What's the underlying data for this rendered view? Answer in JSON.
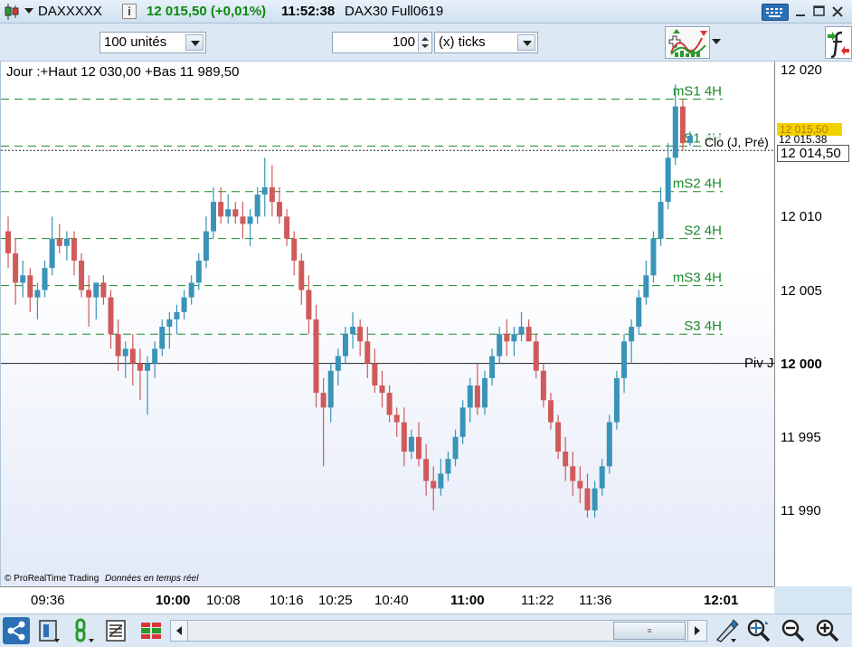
{
  "title": {
    "symbol": "DAXXXXX",
    "info_icon": "i",
    "price_change": "12 015,50 (+0,01%)",
    "time": "11:52:38",
    "instrument": "DAX30 Full0619"
  },
  "toolbar": {
    "units_value": "100 unités",
    "ticks_value": "100",
    "ticks_unit": "(x) ticks"
  },
  "chart": {
    "header_text": "Jour :+Haut 12 030,00 +Bas 11 989,50",
    "copyright": "© ProRealTime Trading",
    "realtime": "Données en temps réel",
    "levels": [
      {
        "label": "mS1 4H"
      },
      {
        "label": "S1 4H"
      },
      {
        "label": "mS2 4H"
      },
      {
        "label": "S2 4H"
      },
      {
        "label": "mS3 4H"
      },
      {
        "label": "S3 4H"
      }
    ],
    "clo_label": "Clo (J, Pré)",
    "piv_label": "Piv J"
  },
  "price_axis": {
    "ticks": [
      "12 020",
      "12 010",
      "12 005",
      "11 995",
      "11 990"
    ],
    "bold_tick": "12 000",
    "last_price": "12 015,50",
    "clo_price": "12 015.38",
    "prev_price": "12 014,50"
  },
  "time_axis": {
    "labels": [
      "09:36",
      "10:00",
      "10:08",
      "10:16",
      "10:25",
      "10:40",
      "11:00",
      "11:22",
      "11:36",
      "12:01"
    ],
    "bold": [
      "10:00",
      "11:00",
      "12:01"
    ]
  },
  "chart_data": {
    "type": "candlestick",
    "ylim": [
      11987,
      12021
    ],
    "levels": {
      "mS1 4H": 12018,
      "S1 4H": 12014.8,
      "mS2 4H": 12011.7,
      "S2 4H": 12008.5,
      "mS3 4H": 12005.3,
      "S3 4H": 12002,
      "Piv J": 12000,
      "Clo": 12014.5
    },
    "candles": [
      [
        12009,
        12010,
        12006.5,
        12007.5
      ],
      [
        12007.5,
        12008.5,
        12004,
        12005.5
      ],
      [
        12005.5,
        12007,
        12004.5,
        12006
      ],
      [
        12006,
        12006.5,
        12003.5,
        12004.5
      ],
      [
        12004.5,
        12005.5,
        12003,
        12005
      ],
      [
        12005,
        12007,
        12004.5,
        12006.5
      ],
      [
        12006.5,
        12010,
        12006,
        12008.5
      ],
      [
        12008.5,
        12009.5,
        12007.5,
        12008
      ],
      [
        12008,
        12009,
        12007,
        12008.5
      ],
      [
        12008.5,
        12009,
        12006,
        12007
      ],
      [
        12007,
        12007.5,
        12004.5,
        12005
      ],
      [
        12005,
        12006,
        12002.5,
        12004.5
      ],
      [
        12004.5,
        12005.5,
        12003,
        12005.5
      ],
      [
        12005.5,
        12006,
        12004,
        12004.5
      ],
      [
        12004.5,
        12005,
        12001,
        12002
      ],
      [
        12002,
        12003,
        11999.5,
        12000.5
      ],
      [
        12000.5,
        12001.5,
        11999,
        12001
      ],
      [
        12001,
        12002,
        11998.5,
        12000
      ],
      [
        12000,
        12001,
        11997.5,
        11999.5
      ],
      [
        11999.5,
        12000.5,
        11996.5,
        12000
      ],
      [
        12000,
        12001.5,
        11999,
        12001
      ],
      [
        12001,
        12003,
        12000.5,
        12002.5
      ],
      [
        12002.5,
        12003.5,
        12001,
        12003
      ],
      [
        12003,
        12004,
        12002,
        12003.5
      ],
      [
        12003.5,
        12005,
        12003,
        12004.5
      ],
      [
        12004.5,
        12006,
        12004,
        12005.5
      ],
      [
        12005.5,
        12007.5,
        12005,
        12007
      ],
      [
        12007,
        12010,
        12006.5,
        12009
      ],
      [
        12009,
        12012,
        12008.5,
        12011
      ],
      [
        12011,
        12012,
        12009.5,
        12010
      ],
      [
        12010,
        12011.5,
        12009.5,
        12010.5
      ],
      [
        12010.5,
        12011,
        12009.5,
        12010
      ],
      [
        12010,
        12011,
        12008.5,
        12009.5
      ],
      [
        12009.5,
        12010.5,
        12008,
        12010
      ],
      [
        12010,
        12012,
        12009.5,
        12011.5
      ],
      [
        12011.5,
        12014,
        12010,
        12012
      ],
      [
        12012,
        12013.5,
        12010,
        12011
      ],
      [
        12011,
        12012,
        12009.5,
        12010
      ],
      [
        12010,
        12010.5,
        12008,
        12008.5
      ],
      [
        12008.5,
        12009,
        12006,
        12007
      ],
      [
        12007,
        12007.5,
        12004,
        12005
      ],
      [
        12005,
        12006,
        12002,
        12003
      ],
      [
        12003,
        12004,
        11997,
        11998
      ],
      [
        11998,
        11999,
        11993,
        11997
      ],
      [
        11997,
        12000,
        11996,
        11999.5
      ],
      [
        11999.5,
        12001,
        11998.5,
        12000.5
      ],
      [
        12000.5,
        12002.5,
        12000,
        12002
      ],
      [
        12002,
        12003.5,
        12001,
        12002.5
      ],
      [
        12002.5,
        12003,
        12000.5,
        12001.5
      ],
      [
        12001.5,
        12002.5,
        11999,
        12000
      ],
      [
        12000,
        12001,
        11998,
        11998.5
      ],
      [
        11998.5,
        11999.5,
        11997,
        11998
      ],
      [
        11998,
        11998.5,
        11996,
        11996.5
      ],
      [
        11996.5,
        11997,
        11995,
        11996
      ],
      [
        11996,
        11997,
        11993,
        11994
      ],
      [
        11994,
        11995.5,
        11993.5,
        11995
      ],
      [
        11995,
        11996,
        11993,
        11993.5
      ],
      [
        11993.5,
        11994.5,
        11991,
        11992
      ],
      [
        11992,
        11993,
        11990,
        11991.5
      ],
      [
        11991.5,
        11993.5,
        11991,
        11992.5
      ],
      [
        11992.5,
        11994,
        11992,
        11993.5
      ],
      [
        11993.5,
        11995.5,
        11993,
        11995
      ],
      [
        11995,
        11997.5,
        11994.5,
        11997
      ],
      [
        11997,
        11999,
        11996,
        11998.5
      ],
      [
        11998.5,
        12000,
        11996.5,
        11997
      ],
      [
        11997,
        11999.5,
        11996.5,
        11999
      ],
      [
        11999,
        12001,
        11998.5,
        12000.5
      ],
      [
        12000.5,
        12002.5,
        12000,
        12002
      ],
      [
        12002,
        12003,
        12000.5,
        12001.5
      ],
      [
        12001.5,
        12002.5,
        12000.5,
        12002
      ],
      [
        12002,
        12003.5,
        12001.5,
        12002.5
      ],
      [
        12002.5,
        12003,
        12001.5,
        12001.5
      ],
      [
        12001.5,
        12002,
        11999,
        11999.5
      ],
      [
        11999.5,
        12000,
        11997,
        11997.5
      ],
      [
        11997.5,
        11998,
        11995.5,
        11996
      ],
      [
        11996,
        11996.5,
        11993.5,
        11994
      ],
      [
        11994,
        11995,
        11992,
        11993
      ],
      [
        11993,
        11994,
        11991,
        11992
      ],
      [
        11992,
        11993,
        11990.5,
        11991.5
      ],
      [
        11991.5,
        11992.5,
        11989.5,
        11990
      ],
      [
        11990,
        11992,
        11989.5,
        11991.5
      ],
      [
        11991.5,
        11993.5,
        11991,
        11993
      ],
      [
        11993,
        11996.5,
        11992.5,
        11996
      ],
      [
        11996,
        11999.5,
        11995.5,
        11999
      ],
      [
        11999,
        12002,
        11998,
        12001.5
      ],
      [
        12001.5,
        12003,
        12000,
        12002.5
      ],
      [
        12002.5,
        12005,
        12002,
        12004.5
      ],
      [
        12004.5,
        12007,
        12004,
        12006
      ],
      [
        12006,
        12009,
        12005.5,
        12008.5
      ],
      [
        12008.5,
        12012,
        12008,
        12011
      ],
      [
        12011,
        12015,
        12010.5,
        12014
      ],
      [
        12014,
        12019,
        12013.5,
        12017.5
      ],
      [
        12017.5,
        12018,
        12014.5,
        12015
      ],
      [
        12015,
        12015.8,
        12014.8,
        12015.5
      ]
    ]
  },
  "icons": {
    "app": "candle-icon",
    "keyboard": "keyboard-icon",
    "minimize": "minimize-icon",
    "maximize": "maximize-icon",
    "close": "close-icon",
    "indicators": "indicators-icon",
    "spinner": "spinner-icon",
    "share": "share-icon",
    "layout": "layout-icon",
    "link": "link-icon",
    "list": "list-icon",
    "bricks": "bricks-icon",
    "draw": "draw-icon",
    "zoom_fit": "zoom-fit-icon",
    "zoom_out": "zoom-out-icon",
    "zoom_in": "zoom-in-icon",
    "side_f": "side-f-icon"
  },
  "colors": {
    "up": "#3a93b8",
    "down": "#d05a5a",
    "level": "#1a8a2a",
    "highlight": "#f4d200"
  }
}
